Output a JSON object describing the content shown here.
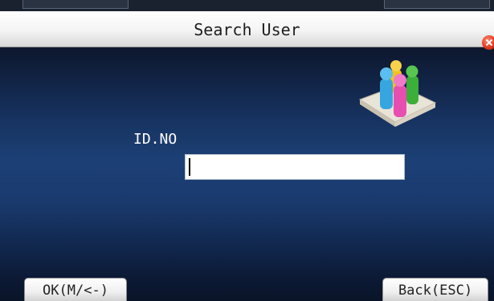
{
  "window": {
    "title": "Search User"
  },
  "form": {
    "id_label": "ID.NO",
    "id_value": ""
  },
  "footer": {
    "ok_label": "OK(M/<-)",
    "back_label": "Back(ESC)"
  },
  "icons": {
    "close": "close-icon",
    "users": "users-group-icon"
  },
  "colors": {
    "close_red": "#e23a1e",
    "person_blue": "#37a6e0",
    "person_pink": "#e64fb0",
    "person_green": "#3cae3a",
    "person_yellow": "#f2c21a"
  }
}
